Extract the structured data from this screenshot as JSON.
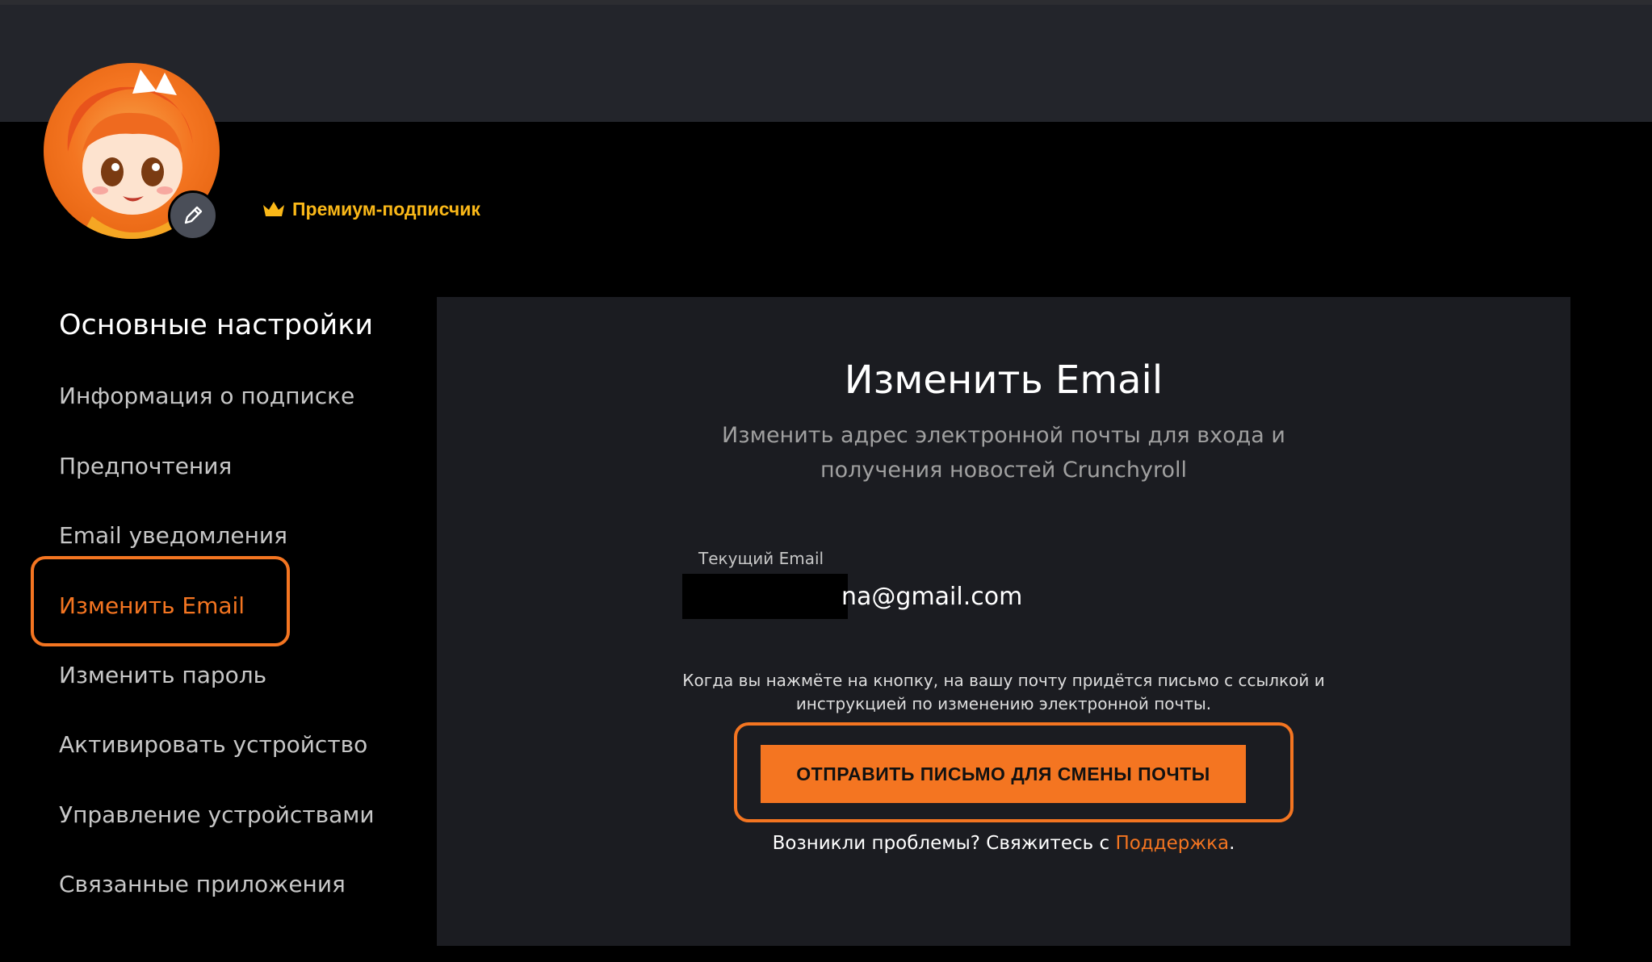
{
  "profile": {
    "avatar_icon": "crunchyroll-hime-avatar",
    "edit_icon": "pencil-icon",
    "premium_icon": "crown-icon",
    "premium_label": "Премиум-подписчик"
  },
  "sidebar": {
    "heading": "Основные настройки",
    "items": [
      {
        "label": "Информация о подписке"
      },
      {
        "label": "Предпочтения"
      },
      {
        "label": "Email уведомления"
      },
      {
        "label": "Изменить Email",
        "active": true
      },
      {
        "label": "Изменить пароль"
      },
      {
        "label": "Активировать устройство"
      },
      {
        "label": "Управление устройствами"
      },
      {
        "label": "Связанные приложения"
      }
    ]
  },
  "panel": {
    "title": "Изменить Email",
    "subtitle_line1": "Изменить адрес электронной почты для входа и",
    "subtitle_line2": "получения новостей Crunchyroll",
    "current_email_label": "Текущий Email",
    "current_email_visible": "na@gmail.com",
    "note_line1": "Когда вы нажмёте на кнопку, на вашу почту придётся письмо с ссылкой и",
    "note_line2": "инструкцией по изменению электронной почты.",
    "send_button_label": "ОТПРАВИТЬ ПИСЬМО ДЛЯ СМЕНЫ ПОЧТЫ",
    "help_prefix": "Возникли проблемы? Свяжитесь с ",
    "help_link": "Поддержка",
    "help_suffix": "."
  },
  "colors": {
    "accent": "#f47521",
    "premium": "#fab818",
    "panel_bg": "#1b1c21",
    "header_bg": "#23252b"
  }
}
